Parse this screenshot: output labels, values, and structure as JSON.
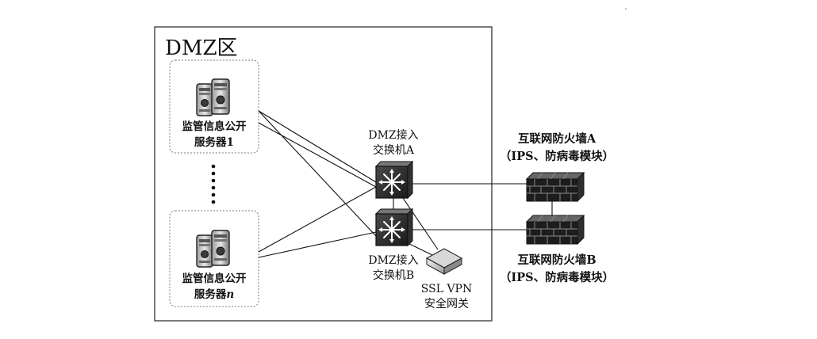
{
  "zone_title": "DMZ区",
  "server1": {
    "line1": "监管信息公开",
    "line2": "服务器1"
  },
  "servern": {
    "line1": "监管信息公开",
    "line2_prefix": "服务器",
    "line2_var": "n"
  },
  "switchA": {
    "line1": "DMZ接入",
    "line2": "交换机A"
  },
  "switchB": {
    "line1": "DMZ接入",
    "line2": "交换机B"
  },
  "vpn": {
    "line1": "SSL VPN",
    "line2": "安全网关"
  },
  "firewallA": {
    "line1": "互联网防火墙A",
    "line2": "（IPS、防病毒模块）"
  },
  "firewallB": {
    "line1": "互联网防火墙B",
    "line2": "（IPS、防病毒模块）"
  },
  "icons": {
    "server": "server-pair-icon",
    "switch": "switch-icon",
    "firewall": "firewall-icon",
    "vpn": "vpn-gateway-icon",
    "ellipsis": "vertical-dots"
  }
}
